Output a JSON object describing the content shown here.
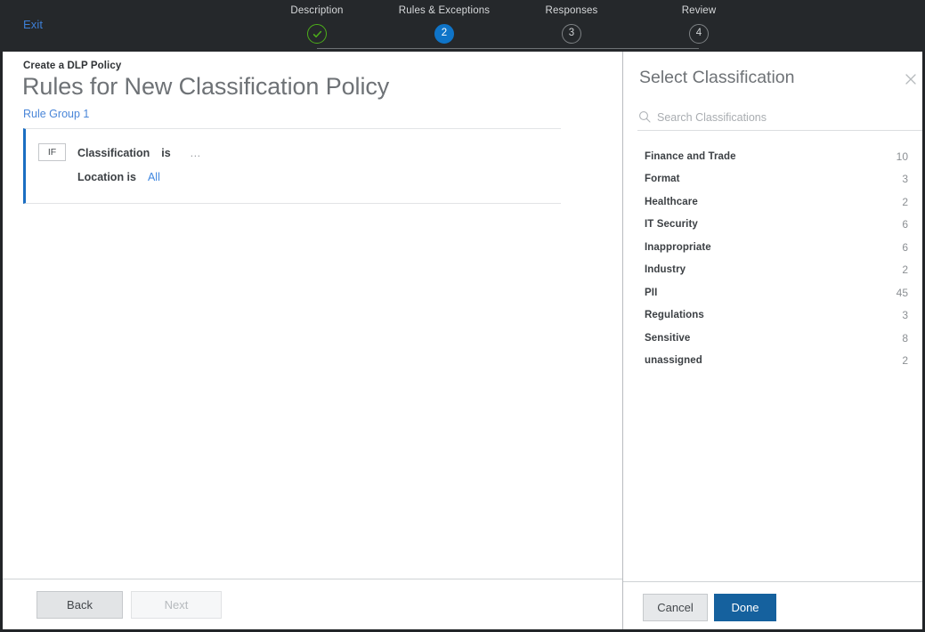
{
  "topbar": {
    "exit_label": "Exit",
    "steps": [
      {
        "label": "Description",
        "marker": "✓",
        "state": "done"
      },
      {
        "label": "Rules & Exceptions",
        "marker": "2",
        "state": "current"
      },
      {
        "label": "Responses",
        "marker": "3",
        "state": "pending"
      },
      {
        "label": "Review",
        "marker": "4",
        "state": "pending"
      }
    ]
  },
  "main": {
    "breadcrumb": "Create a DLP Policy",
    "title": "Rules for New Classification Policy",
    "rule_group_label": "Rule Group 1",
    "rule": {
      "if_chip": "IF",
      "condition_subject": "Classification",
      "condition_operator": "is",
      "condition_value": "…",
      "location_text": "Location is",
      "location_value": "All"
    },
    "footer": {
      "back_label": "Back",
      "next_label": "Next"
    }
  },
  "drawer": {
    "title": "Select Classification",
    "close_icon": "close-icon",
    "search": {
      "icon": "search-icon",
      "placeholder": "Search Classifications",
      "value": ""
    },
    "items": [
      {
        "name": "Finance and Trade",
        "count": "10"
      },
      {
        "name": "Format",
        "count": "3"
      },
      {
        "name": "Healthcare",
        "count": "2"
      },
      {
        "name": "IT Security",
        "count": "6"
      },
      {
        "name": "Inappropriate",
        "count": "6"
      },
      {
        "name": "Industry",
        "count": "2"
      },
      {
        "name": "PII",
        "count": "45"
      },
      {
        "name": "Regulations",
        "count": "3"
      },
      {
        "name": "Sensitive",
        "count": "8"
      },
      {
        "name": "unassigned",
        "count": "2"
      }
    ],
    "footer": {
      "cancel_label": "Cancel",
      "done_label": "Done"
    }
  },
  "colors": {
    "topbar_bg": "#25282b",
    "accent_blue": "#0f74c8",
    "primary_button": "#15619e",
    "link_blue": "#4a86d8",
    "step_done_green": "#4caf19",
    "rule_accent": "#1b6ec2"
  }
}
